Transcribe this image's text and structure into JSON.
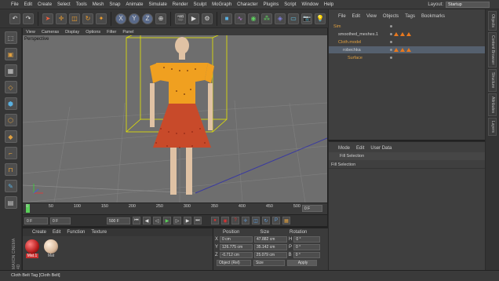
{
  "menubar": {
    "items": [
      "File",
      "Edit",
      "Create",
      "Select",
      "Tools",
      "Mesh",
      "Snap",
      "Animate",
      "Simulate",
      "Render",
      "Sculpt",
      "MoGraph",
      "Character",
      "Plugins",
      "Script",
      "Window",
      "Help"
    ],
    "layout_label": "Layout:",
    "layout_value": "Startup"
  },
  "toolbar": {
    "icons": [
      "undo-icon",
      "redo-icon",
      "select-icon",
      "move-icon",
      "scale-icon",
      "rotate-icon",
      "recent-tools-icon",
      "x-axis-icon",
      "y-axis-icon",
      "z-axis-icon",
      "coord-system-icon",
      "render-view-icon",
      "render-pv-icon",
      "render-settings-icon",
      "cube-icon",
      "spline-icon",
      "nurbs-icon",
      "array-icon",
      "deformer-icon",
      "floor-icon",
      "camera-icon",
      "light-icon"
    ],
    "axis_labels": [
      "X",
      "Y",
      "Z"
    ]
  },
  "viewport": {
    "menu": [
      "View",
      "Cameras",
      "Display",
      "Options",
      "Filter",
      "Panel"
    ],
    "label": "Perspective",
    "colors": {
      "background": "#6e6e6e",
      "grid": "#7d7d7d",
      "cage": "#e6e600",
      "cloth": "#c84a2a",
      "points": "#f0a020",
      "skin": "#e0c2a4"
    }
  },
  "timeline": {
    "ticks": [
      "0",
      "50",
      "100",
      "150",
      "200",
      "250",
      "300",
      "350",
      "400",
      "450",
      "500"
    ],
    "current_frame": "0 F"
  },
  "transport": {
    "start_field": "0 F",
    "mid_field": "0 F",
    "end_field": "500 F"
  },
  "material_manager": {
    "menu": [
      "Create",
      "Edit",
      "Function",
      "Texture"
    ],
    "materials": [
      {
        "name": "Mat.1",
        "color": "#b81c1c"
      },
      {
        "name": "Mat",
        "color": "#d9b89a"
      }
    ]
  },
  "coordinates": {
    "headers": [
      "Position",
      "Size",
      "Rotation"
    ],
    "rows": [
      {
        "axis": "X",
        "pos": "0 cm",
        "size": "47.882 cm",
        "rot_axis": "H",
        "rot": "0 °"
      },
      {
        "axis": "Y",
        "pos": "126.775 cm",
        "size": "35.142 cm",
        "rot_axis": "P",
        "rot": "0 °"
      },
      {
        "axis": "Z",
        "pos": "-0.712 cm",
        "size": "25.079 cm",
        "rot_axis": "B",
        "rot": "0 °"
      }
    ],
    "mode_select": "Object (Rel)",
    "size_select": "Size",
    "apply_label": "Apply"
  },
  "object_manager": {
    "menu": [
      "File",
      "Edit",
      "View",
      "Objects",
      "Tags",
      "Bookmarks"
    ],
    "objects": [
      {
        "name": "Sim",
        "indent": 0
      },
      {
        "name": "smoothed_meshes.1",
        "indent": 1
      },
      {
        "name": "Cloth.model",
        "indent": 1
      },
      {
        "name": "robechka",
        "indent": 2
      },
      {
        "name": "Surface",
        "indent": 3
      }
    ]
  },
  "attribute_manager": {
    "menu": [
      "Mode",
      "Edit",
      "User Data"
    ],
    "line1": "Fill Selection",
    "line2": "Fill Selection"
  },
  "right_tabs": [
    "Objects",
    "Content Browser",
    "Structure",
    "Attributes",
    "Layers"
  ],
  "statusbar": {
    "text": "Cloth Belt Tag [Cloth Belt]"
  }
}
